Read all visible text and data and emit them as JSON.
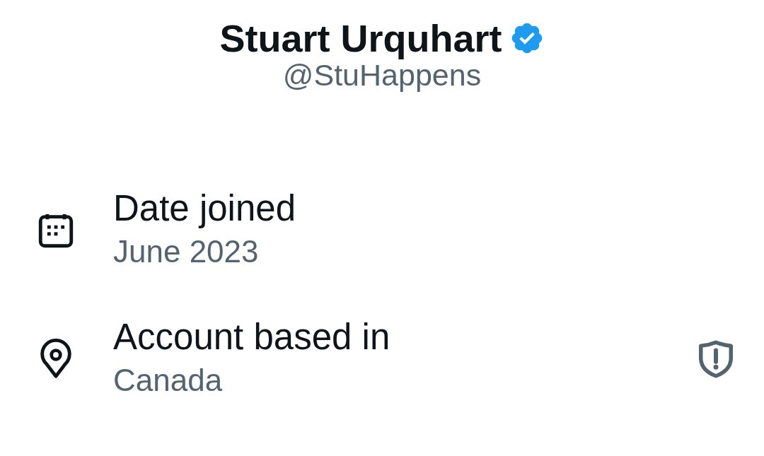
{
  "profile": {
    "name": "Stuart Urquhart",
    "verified": true,
    "handle": "@StuHappens"
  },
  "details": [
    {
      "kind": "date",
      "label": "Date joined",
      "value": "June 2023",
      "shield": false
    },
    {
      "kind": "location",
      "label": "Account based in",
      "value": "Canada",
      "shield": true
    }
  ]
}
